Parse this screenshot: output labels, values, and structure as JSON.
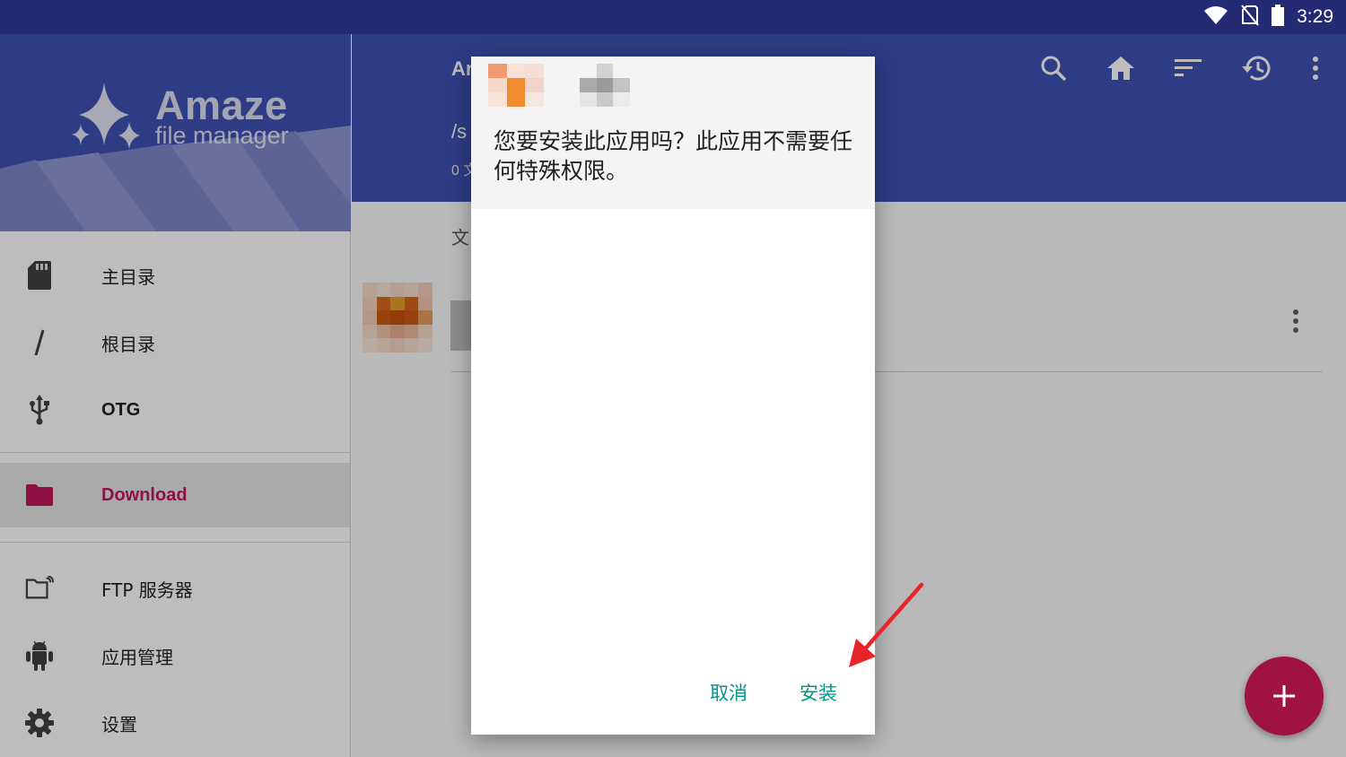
{
  "status_bar": {
    "time": "3:29",
    "icons": [
      "wifi-icon",
      "no-sim-icon",
      "battery-icon"
    ]
  },
  "drawer": {
    "logo": {
      "title": "Amaze",
      "subtitle": "file manager"
    },
    "items": [
      {
        "label": "主目录",
        "icon": "sd-card-icon"
      },
      {
        "label": "根目录",
        "icon": "slash-icon"
      },
      {
        "label": "OTG",
        "icon": "usb-icon"
      },
      {
        "label": "Download",
        "icon": "folder-icon",
        "active": true
      },
      {
        "label": "FTP 服务器",
        "icon": "ftp-folder-icon"
      },
      {
        "label": "应用管理",
        "icon": "android-icon"
      },
      {
        "label": "设置",
        "icon": "gear-icon"
      }
    ]
  },
  "appbar": {
    "title": "Ar",
    "path": "/s",
    "count": "0 文",
    "actions": [
      "search-icon",
      "home-icon",
      "sort-icon",
      "history-icon",
      "more-vert-icon"
    ]
  },
  "content": {
    "section_label": "文"
  },
  "dialog": {
    "question": "您要安装此应用吗？此应用不需要任何特殊权限。",
    "cancel_label": "取消",
    "install_label": "安装"
  },
  "colors": {
    "primary": "#3f51b5",
    "status_bar": "#242b75",
    "accent": "#c2185b",
    "fab": "#a0123f",
    "dialog_button": "#009688",
    "annotation_arrow": "#e8242a"
  }
}
